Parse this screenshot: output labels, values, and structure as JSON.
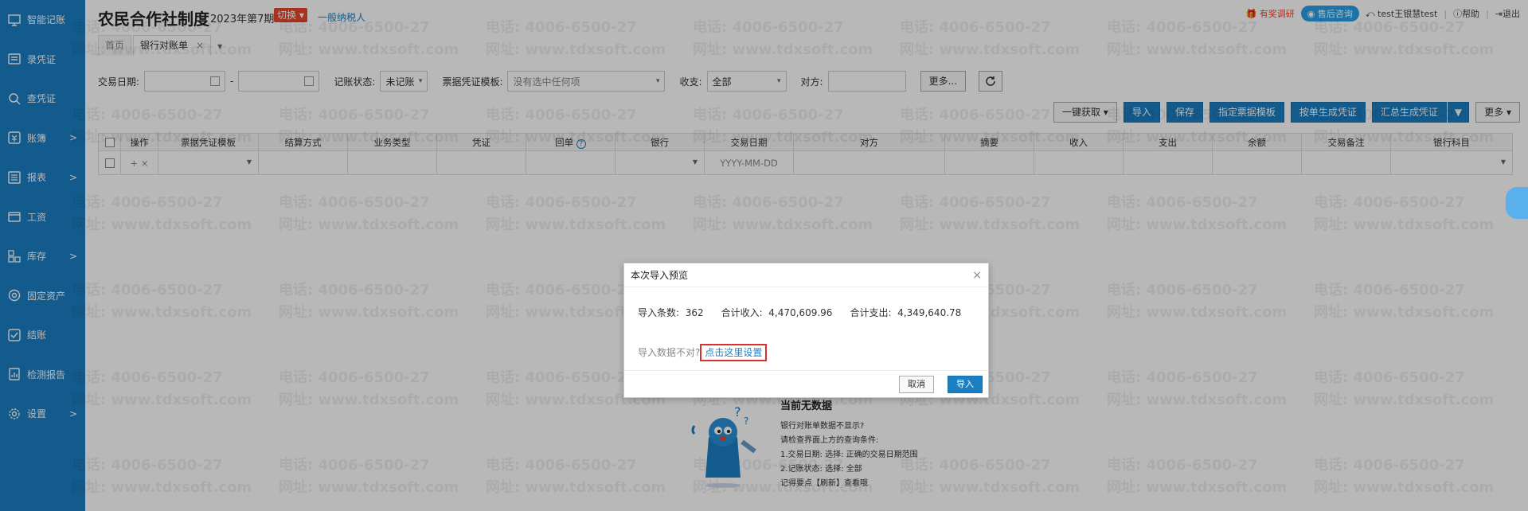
{
  "sidebar": {
    "items": [
      {
        "label": "智能记账",
        "icon": "monitor-icon",
        "arrow": ""
      },
      {
        "label": "录凭证",
        "icon": "voucher-icon",
        "arrow": ""
      },
      {
        "label": "查凭证",
        "icon": "search-icon",
        "arrow": ""
      },
      {
        "label": "账簿",
        "icon": "ledger-icon",
        "arrow": ">"
      },
      {
        "label": "报表",
        "icon": "report-icon",
        "arrow": ">"
      },
      {
        "label": "工资",
        "icon": "wallet-icon",
        "arrow": ""
      },
      {
        "label": "库存",
        "icon": "inventory-icon",
        "arrow": ">"
      },
      {
        "label": "固定资产",
        "icon": "asset-icon",
        "arrow": ""
      },
      {
        "label": "结账",
        "icon": "checkout-icon",
        "arrow": ""
      },
      {
        "label": "检测报告",
        "icon": "chart-report-icon",
        "arrow": ""
      },
      {
        "label": "设置",
        "icon": "gear-icon",
        "arrow": ">"
      }
    ]
  },
  "header": {
    "title": "农民合作社制度",
    "period": "2023年第7期",
    "switch_label": "切换",
    "taxpayer": "一般纳税人",
    "topright": {
      "survey": "有奖调研",
      "consult": "售后咨询",
      "user": "test王银慧test",
      "help": "帮助",
      "logout": "退出"
    }
  },
  "tabs": [
    {
      "label": "首页"
    },
    {
      "label": "银行对账单",
      "close": "×"
    }
  ],
  "filter": {
    "date_label": "交易日期:",
    "status_label": "记账状态:",
    "status_value": "未记账",
    "template_label": "票据凭证模板:",
    "template_placeholder": "没有选中任何项",
    "income_label": "收支:",
    "income_value": "全部",
    "counterparty_label": "对方:",
    "more_label": "更多..."
  },
  "actions": {
    "fetch": "一键获取",
    "import": "导入",
    "save": "保存",
    "assign_template": "指定票据模板",
    "gen_single": "按单生成凭证",
    "gen_summary": "汇总生成凭证",
    "more": "更多"
  },
  "table": {
    "headers": [
      "操作",
      "票据凭证模板",
      "结算方式",
      "业务类型",
      "凭证",
      "回单",
      "银行",
      "交易日期",
      "对方",
      "摘要",
      "收入",
      "支出",
      "余额",
      "交易备注",
      "银行科目"
    ],
    "row_ops": "+ ×",
    "date_placeholder": "YYYY-MM-DD"
  },
  "watermark": {
    "phone": "电话: 4006-6500-27",
    "site": "网址: www.tdxsoft.com"
  },
  "empty_state": {
    "title": "当前无数据",
    "lines": [
      "银行对账单数据不显示?",
      "请检查界面上方的查询条件:",
      "1.交易日期:  选择:  正确的交易日期范围",
      "2.记账状态:  选择:  全部",
      "记得要点【刷新】查看哦"
    ]
  },
  "dialog": {
    "title": "本次导入预览",
    "count_label": "导入条数:",
    "count_value": "362",
    "income_label": "合计收入:",
    "income_value": "4,470,609.96",
    "expense_label": "合计支出:",
    "expense_value": "4,349,640.78",
    "hint": "导入数据不对?",
    "link": "点击这里设置",
    "cancel": "取消",
    "ok": "导入"
  },
  "colors": {
    "sidebar": "#1c7fc4",
    "accent": "#1c7fc4",
    "switch": "#e8462c",
    "highlight": "#d93030"
  }
}
